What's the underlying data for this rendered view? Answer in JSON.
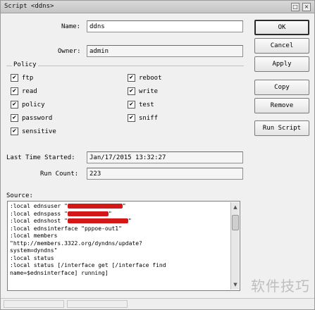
{
  "window": {
    "title": "Script <ddns>",
    "minimize_glyph": "□",
    "close_glyph": "×"
  },
  "form": {
    "name_label": "Name:",
    "name_value": "ddns",
    "owner_label": "Owner:",
    "owner_value": "admin",
    "policy_label": "Policy",
    "policies": [
      {
        "label": "ftp",
        "checked": true
      },
      {
        "label": "reboot",
        "checked": true
      },
      {
        "label": "read",
        "checked": true
      },
      {
        "label": "write",
        "checked": true
      },
      {
        "label": "policy",
        "checked": true
      },
      {
        "label": "test",
        "checked": true
      },
      {
        "label": "password",
        "checked": true
      },
      {
        "label": "sniff",
        "checked": true
      },
      {
        "label": "sensitive",
        "checked": true
      }
    ],
    "last_started_label": "Last Time Started:",
    "last_started_value": "Jan/17/2015 13:32:27",
    "run_count_label": "Run Count:",
    "run_count_value": "223",
    "source_label": "Source:",
    "check_glyph": "✔"
  },
  "buttons": {
    "ok": "OK",
    "cancel": "Cancel",
    "apply": "Apply",
    "copy": "Copy",
    "remove": "Remove",
    "run_script": "Run Script"
  },
  "source_lines": [
    {
      "text": ":local ednsuser \"",
      "tail": "\"",
      "redacted": true
    },
    {
      "text": ":local ednspass \"",
      "tail": "\"",
      "redacted": true
    },
    {
      "text": ":local ednshost \"",
      "tail": "\"",
      "redacted": true
    },
    {
      "text": ":local ednsinterface \"pppoe-out1\"",
      "tail": "",
      "redacted": false
    },
    {
      "text": ":local members",
      "tail": "",
      "redacted": false
    },
    {
      "text": "\"http://members.3322.org/dyndns/update?",
      "tail": "",
      "redacted": false
    },
    {
      "text": "system=dyndns\"",
      "tail": "",
      "redacted": false
    },
    {
      "text": ":local status",
      "tail": "",
      "redacted": false
    },
    {
      "text": ":local status [/interface get [/interface find",
      "tail": "",
      "redacted": false
    },
    {
      "text": "name=$ednsinterface] running]",
      "tail": "",
      "redacted": false
    }
  ],
  "scrollbar": {
    "up_glyph": "▲",
    "down_glyph": "▼"
  },
  "watermark": "软件技巧"
}
